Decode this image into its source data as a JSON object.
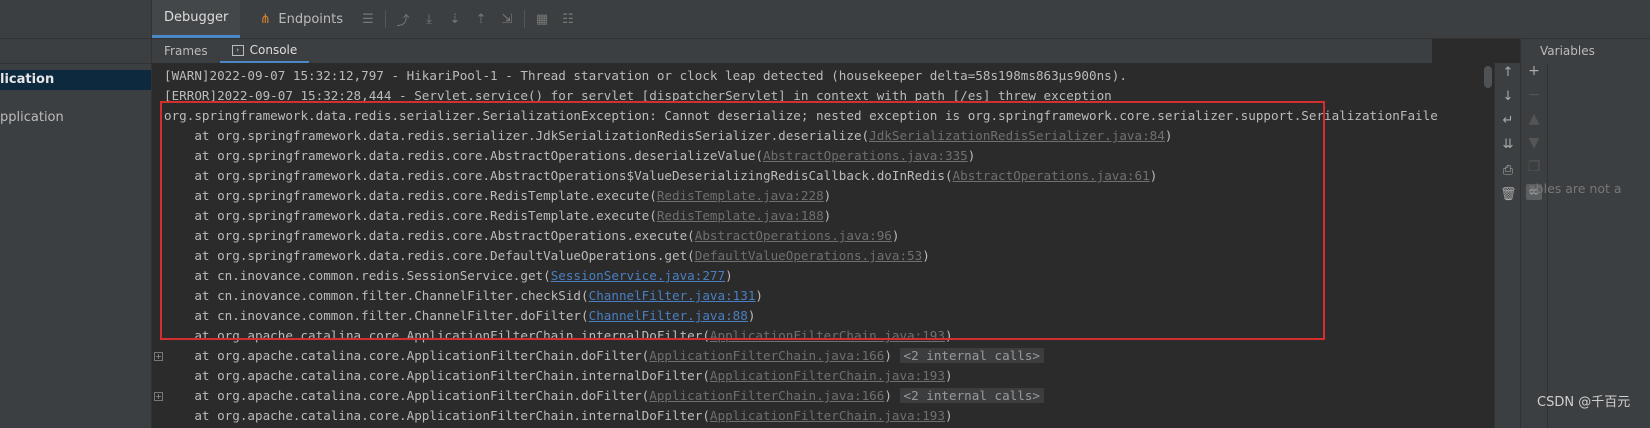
{
  "left_panel": {
    "items": [
      {
        "label": "lication",
        "selected": true
      },
      {
        "label": "pplication",
        "selected": false
      }
    ]
  },
  "toolbar": {
    "tabs": [
      {
        "label": "Debugger",
        "active": true
      },
      {
        "label": "Endpoints",
        "active": false
      }
    ]
  },
  "subtabs": [
    {
      "label": "Frames",
      "active": false
    },
    {
      "label": "Console",
      "active": true
    }
  ],
  "console": {
    "lines": [
      {
        "text": "[WARN]2022-09-07 15:32:12,797 - HikariPool-1 - Thread starvation or clock leap detected (housekeeper delta=58s198ms863µs900ns)."
      },
      {
        "text": "[ERROR]2022-09-07 15:32:28,444 - Servlet.service() for servlet [dispatcherServlet] in context with path [/es] threw exception"
      },
      {
        "text": "org.springframework.data.redis.serializer.SerializationException: Cannot deserialize; nested exception is org.springframework.core.serializer.support.SerializationFaile"
      },
      {
        "prefix": "    at org.springframework.data.redis.serializer.JdkSerializationRedisSerializer.deserialize(",
        "link": "JdkSerializationRedisSerializer.java:84",
        "suffix": ")",
        "gray": true
      },
      {
        "prefix": "    at org.springframework.data.redis.core.AbstractOperations.deserializeValue(",
        "link": "AbstractOperations.java:335",
        "suffix": ")",
        "gray": true
      },
      {
        "prefix": "    at org.springframework.data.redis.core.AbstractOperations$ValueDeserializingRedisCallback.doInRedis(",
        "link": "AbstractOperations.java:61",
        "suffix": ")",
        "gray": true
      },
      {
        "prefix": "    at org.springframework.data.redis.core.RedisTemplate.execute(",
        "link": "RedisTemplate.java:228",
        "suffix": ")",
        "gray": true
      },
      {
        "prefix": "    at org.springframework.data.redis.core.RedisTemplate.execute(",
        "link": "RedisTemplate.java:188",
        "suffix": ")",
        "gray": true
      },
      {
        "prefix": "    at org.springframework.data.redis.core.AbstractOperations.execute(",
        "link": "AbstractOperations.java:96",
        "suffix": ")",
        "gray": true
      },
      {
        "prefix": "    at org.springframework.data.redis.core.DefaultValueOperations.get(",
        "link": "DefaultValueOperations.java:53",
        "suffix": ")",
        "gray": true
      },
      {
        "prefix": "    at cn.inovance.common.redis.SessionService.get(",
        "link": "SessionService.java:277",
        "suffix": ")",
        "gray": false
      },
      {
        "prefix": "    at cn.inovance.common.filter.ChannelFilter.checkSid(",
        "link": "ChannelFilter.java:131",
        "suffix": ")",
        "gray": false
      },
      {
        "prefix": "    at cn.inovance.common.filter.ChannelFilter.doFilter(",
        "link": "ChannelFilter.java:88",
        "suffix": ")",
        "gray": false
      },
      {
        "prefix": "    at org.apache.catalina.core.ApplicationFilterChain.internalDoFilter(",
        "link": "ApplicationFilterChain.java:193",
        "suffix": ")",
        "gray": true
      },
      {
        "prefix": "    at org.apache.catalina.core.ApplicationFilterChain.doFilter(",
        "link": "ApplicationFilterChain.java:166",
        "suffix": ")",
        "gray": true,
        "internal": "<2 internal calls>",
        "fold": true
      },
      {
        "prefix": "    at org.apache.catalina.core.ApplicationFilterChain.internalDoFilter(",
        "link": "ApplicationFilterChain.java:193",
        "suffix": ")",
        "gray": true
      },
      {
        "prefix": "    at org.apache.catalina.core.ApplicationFilterChain.doFilter(",
        "link": "ApplicationFilterChain.java:166",
        "suffix": ")",
        "gray": true,
        "internal": "<2 internal calls>",
        "fold": true
      },
      {
        "prefix": "    at org.apache.catalina.core.ApplicationFilterChain.internalDoFilter(",
        "link": "ApplicationFilterChain.java:193",
        "suffix": ")",
        "gray": true
      }
    ]
  },
  "console_tools": [
    "arrow-up-icon",
    "arrow-down-icon",
    "soft-wrap-icon",
    "scroll-to-end-icon",
    "print-icon",
    "trash-icon"
  ],
  "variables": {
    "title": "Variables",
    "empty_text": "ables are not a"
  },
  "watermark": "CSDN @千百元",
  "colors": {
    "highlight": "#d32f2f",
    "link": "#4a7fc1",
    "selection": "#0d293e"
  }
}
